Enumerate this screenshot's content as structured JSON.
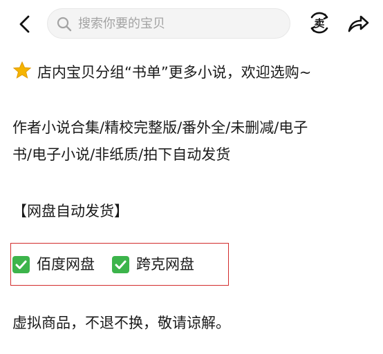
{
  "search": {
    "placeholder": "搜索你要的宝贝"
  },
  "topbar": {
    "sell_icon_label": "卖"
  },
  "description": {
    "line1": "店内宝贝分组“书单”更多小说，欢迎选购~",
    "line2": "作者小说合集/精校完整版/番外全/未删减/电子",
    "line3": "书/电子小说/非纸质/拍下自动发货",
    "line4": "【网盘自动发货】",
    "options": [
      "佰度网盘",
      "跨克网盘"
    ],
    "line6": "虚拟商品，不退不换，敬请谅解。"
  },
  "colors": {
    "highlight_box": "#d22b2b",
    "check_green": "#3cb44b",
    "star": "#f5b400"
  }
}
